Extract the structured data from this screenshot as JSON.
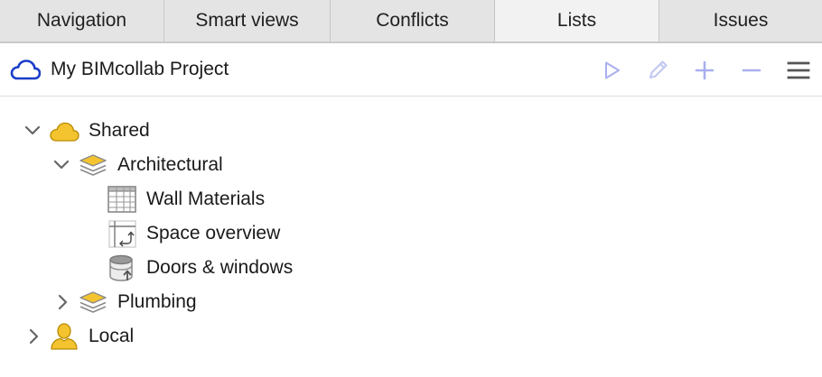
{
  "tabs": [
    {
      "label": "Navigation"
    },
    {
      "label": "Smart views"
    },
    {
      "label": "Conflicts"
    },
    {
      "label": "Lists",
      "active": true
    },
    {
      "label": "Issues"
    }
  ],
  "project": {
    "icon": "cloud-icon",
    "title": "My BIMcollab Project"
  },
  "toolbar": {
    "icons": [
      "play-icon",
      "pencil-icon",
      "plus-icon",
      "minus-icon",
      "menu-icon"
    ]
  },
  "tree": {
    "shared": {
      "label": "Shared",
      "icon": "cloud-icon",
      "expanded": true
    },
    "architectural": {
      "label": "Architectural",
      "icon": "layers-icon",
      "expanded": true
    },
    "wall_materials": {
      "label": "Wall Materials",
      "icon": "table-icon"
    },
    "space_overview": {
      "label": "Space overview",
      "icon": "space-icon"
    },
    "doors_windows": {
      "label": "Doors & windows",
      "icon": "database-icon"
    },
    "plumbing": {
      "label": "Plumbing",
      "icon": "layers-icon",
      "expanded": false
    },
    "local": {
      "label": "Local",
      "icon": "user-icon",
      "expanded": false
    }
  },
  "colors": {
    "accent_blue": "#1a3cc8",
    "toolbar_icon": "#a9b0ee",
    "folder_yellow": "#f4c430"
  }
}
